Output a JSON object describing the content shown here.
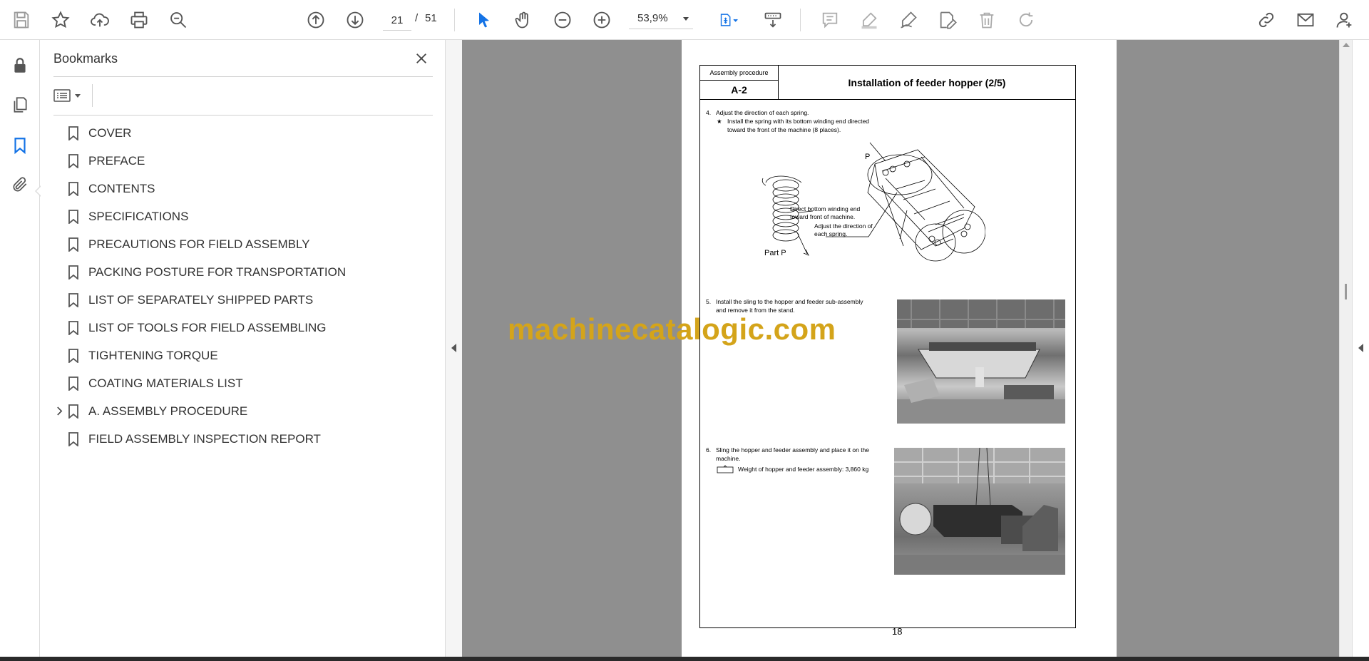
{
  "toolbar": {
    "page_current": "21",
    "page_separator": "/",
    "page_total": "51",
    "zoom_value": "53,9%",
    "accent_color": "#1473e6"
  },
  "bookmarks_panel": {
    "title": "Bookmarks",
    "items": [
      {
        "label": "COVER",
        "expandable": false
      },
      {
        "label": "PREFACE",
        "expandable": false
      },
      {
        "label": "CONTENTS",
        "expandable": false
      },
      {
        "label": "SPECIFICATIONS",
        "expandable": false
      },
      {
        "label": "PRECAUTIONS FOR FIELD ASSEMBLY",
        "expandable": false
      },
      {
        "label": "PACKING POSTURE FOR TRANSPORTATION",
        "expandable": false
      },
      {
        "label": "LIST OF SEPARATELY SHIPPED PARTS",
        "expandable": false
      },
      {
        "label": "LIST OF TOOLS FOR FIELD ASSEMBLING",
        "expandable": false
      },
      {
        "label": "TIGHTENING TORQUE",
        "expandable": false
      },
      {
        "label": "COATING MATERIALS LIST",
        "expandable": false
      },
      {
        "label": "A. ASSEMBLY PROCEDURE",
        "expandable": true
      },
      {
        "label": "FIELD ASSEMBLY INSPECTION REPORT",
        "expandable": false
      }
    ]
  },
  "document": {
    "header": {
      "procedure_label": "Assembly procedure",
      "code": "A-2",
      "title": "Installation of feeder hopper (2/5)"
    },
    "steps": [
      {
        "num": "4.",
        "text": "Adjust the direction of each spring."
      },
      {
        "num": "5.",
        "line1": "Install the sling to the hopper and feeder sub-assembly",
        "line2": "and remove it from the stand."
      },
      {
        "num": "6.",
        "line1": "Sling the hopper and feeder assembly and place it on the",
        "line2": "machine."
      }
    ],
    "step4_note": {
      "mark": "★",
      "line1": "Install the spring with its bottom winding end directed",
      "line2": "toward the front of the machine (8 places)."
    },
    "figure": {
      "label_p": "P",
      "part_label": "Part P",
      "callout1_line1": "Direct bottom winding end",
      "callout1_line2": "toward front of machine.",
      "callout2_line1": "Adjust the direction of",
      "callout2_line2": "each spring."
    },
    "weight_note": "Weight of hopper and feeder assembly: 3,860 kg",
    "page_number": "18"
  },
  "watermark": "machinecatalogic.com"
}
